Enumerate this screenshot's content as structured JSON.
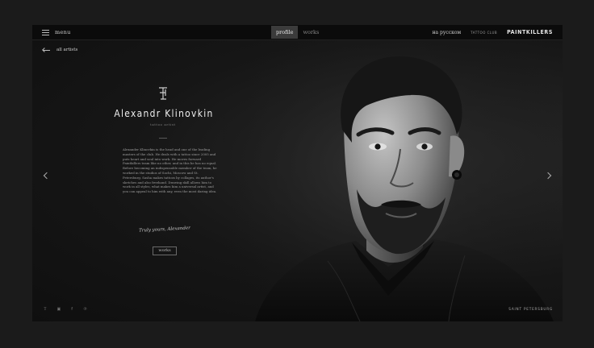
{
  "header": {
    "menu_label": "menu",
    "tabs": [
      {
        "label": "profile",
        "active": true
      },
      {
        "label": "works",
        "active": false
      }
    ],
    "language": "на русском",
    "club_label": "TATTOO CLUB",
    "brand": "PAINTKILLERS"
  },
  "nav": {
    "back_label": "all artists"
  },
  "artist": {
    "name": "Alexandr Klinovkin",
    "role": "tattoo artist",
    "bio": "Alexander Klinovkin is the head and one of the leading masters of the club. He deals with a tattoo since 2005 and puts heart and soul into work. He moves forward Paintkillers team like no other, and in this he has no equal. Before becoming an indispensable member of the team, he worked in the studios of Sochi, Moscow and St. Petersburg. Sasha makes tattoos by collages, its author's sketches and also freehand. Drawing skill allows him to work in all styles, what makes him a universal artist, and you can appeal to him with any, even the most daring idea.",
    "signature": "Truly yours, Alexander",
    "works_button": "works"
  },
  "footer": {
    "social_icons": [
      "twitter-icon",
      "instagram-icon",
      "facebook-icon",
      "pinterest-icon"
    ],
    "city": "SAINT PETERSBURG"
  },
  "colors": {
    "background": "#1b1b1b",
    "frame": "#141414",
    "topbar": "#0b0b0b",
    "active_tab": "#3b3b3b",
    "text_light": "#efefef",
    "text_muted": "#9e9e9e"
  }
}
